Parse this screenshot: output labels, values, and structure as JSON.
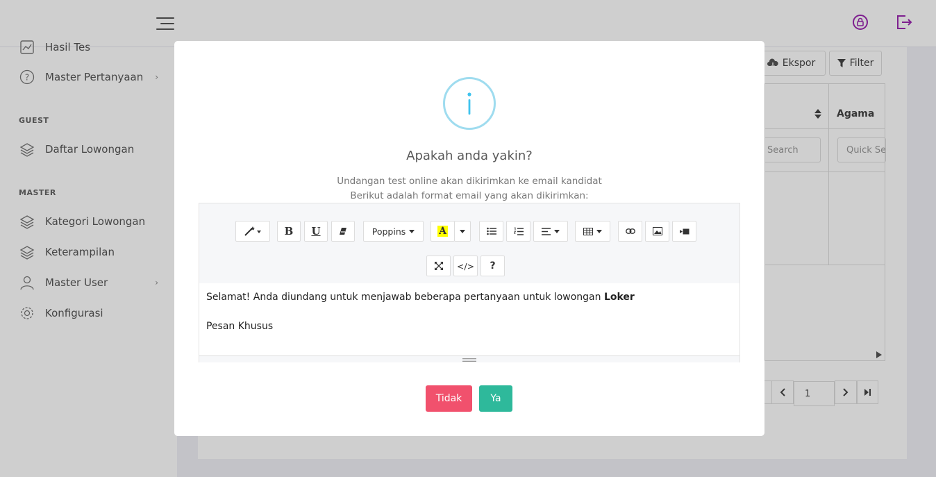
{
  "sidebar": {
    "items_top": [
      {
        "label": "Hasil Tes",
        "icon": "chart-icon"
      },
      {
        "label": "Master Pertanyaan",
        "icon": "question-circle-icon",
        "has_children": true
      }
    ],
    "section_guest": "GUEST",
    "guest_items": [
      {
        "label": "Daftar Lowongan",
        "icon": "layers-icon"
      }
    ],
    "section_master": "MASTER",
    "master_items": [
      {
        "label": "Kategori Lowongan",
        "icon": "layers-icon"
      },
      {
        "label": "Keterampilan",
        "icon": "layers-icon"
      },
      {
        "label": "Master User",
        "icon": "user-icon",
        "has_children": true
      },
      {
        "label": "Konfigurasi",
        "icon": "gear-icon"
      }
    ],
    "chevron": "›"
  },
  "background": {
    "export_label": "Ekspor",
    "filter_label": "Filter",
    "column_header": "Agama",
    "search_placeholder": "Search",
    "quick_search_placeholder": "Quick Se",
    "page_number": "1"
  },
  "modal": {
    "icon": "info-icon",
    "icon_glyph": "i",
    "title": "Apakah anda yakin?",
    "text_line1": "Undangan test online akan dikirimkan ke email kandidat",
    "text_line2": "Berikut adalah format email yang akan dikirimkan:",
    "editor": {
      "font_select": "Poppins",
      "highlight_letter": "A",
      "bold_glyph": "B",
      "underline_glyph": "U",
      "code_glyph": "</>",
      "help_glyph": "?",
      "body_line1": "Selamat! Anda diundang untuk menjawab beberapa pertanyaan untuk lowongan ",
      "body_line1_bold": "Loker",
      "body_line2": "Pesan Khusus"
    },
    "cancel_label": "Tidak",
    "confirm_label": "Ya"
  },
  "colors": {
    "cancel": "#f1516d",
    "confirm": "#2eb99b",
    "info": "#3fc3ee",
    "accent_purple": "#9c27b0",
    "highlight": "#ffff00"
  }
}
